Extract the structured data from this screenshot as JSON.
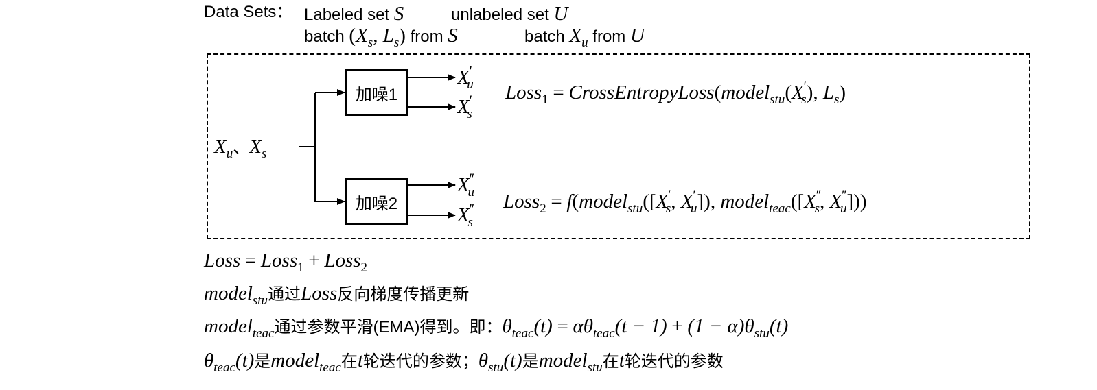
{
  "header": {
    "label": "Data Sets：",
    "labeled_text": "Labeled set",
    "labeled_sym": "S",
    "unlabeled_text": "unlabeled set",
    "unlabeled_sym": "U",
    "batch_text": "batch",
    "batch_xs": "X",
    "batch_s_sub": "s",
    "batch_ls": "L",
    "from_text": "from",
    "batch_u_text": "batch",
    "batch_xu": "X",
    "batch_u_sub": "u",
    "from_u_text": "from"
  },
  "diagram": {
    "input_x": "X",
    "input_u_sub": "u",
    "input_sep": "、",
    "input_s_sub": "s",
    "noise1_label": "加噪1",
    "noise2_label": "加噪2",
    "out1_u": "X",
    "out1_u_sub": "u",
    "out1_u_prime": "′",
    "out1_s": "X",
    "out1_s_sub": "s",
    "out1_s_prime": "′",
    "out2_u": "X",
    "out2_u_sub": "u",
    "out2_u_prime": "″",
    "out2_s": "X",
    "out2_s_sub": "s",
    "out2_s_prime": "″",
    "loss1_name": "Loss",
    "loss1_idx": "1",
    "loss1_eq": "=",
    "loss1_fn": "CrossEntropyLoss",
    "loss1_model": "model",
    "loss1_model_sub": "stu",
    "loss2_name": "Loss",
    "loss2_idx": "2",
    "loss2_eq": "=",
    "loss2_f": "f",
    "loss2_model_stu": "model",
    "loss2_stu_sub": "stu",
    "loss2_model_teac": "model",
    "loss2_teac_sub": "teac"
  },
  "notes": {
    "total_loss": "Loss",
    "total_eq": "=",
    "total_l1": "Loss",
    "total_l1_idx": "1",
    "total_plus": "+",
    "total_l2": "Loss",
    "total_l2_idx": "2",
    "line2_model": "model",
    "line2_sub": "stu",
    "line2_text1": "通过",
    "line2_loss": "Loss",
    "line2_text2": "反向梯度传播更新",
    "line3_model": "model",
    "line3_sub": "teac",
    "line3_text": "通过参数平滑(EMA)得到。即：",
    "line3_theta": "θ",
    "line3_teac": "teac",
    "line3_t": "(t)",
    "line3_eq": "=",
    "line3_alpha": "α",
    "line3_theta2": "θ",
    "line3_teac2": "teac",
    "line3_t1": "(t − 1)",
    "line3_plus": "+",
    "line3_coef": "(1 − α)",
    "line3_theta3": "θ",
    "line3_stu": "stu",
    "line3_t2": "(t)",
    "line4_theta": "θ",
    "line4_teac": "teac",
    "line4_t": "(t)",
    "line4_is": "是",
    "line4_model": "model",
    "line4_model_sub": "teac",
    "line4_in": "在",
    "line4_tvar": "t",
    "line4_round": "轮迭代的参数；",
    "line4_theta2": "θ",
    "line4_stu": "stu",
    "line4_t2": "(t)",
    "line4_is2": "是",
    "line4_model2": "model",
    "line4_model2_sub": "stu",
    "line4_in2": "在",
    "line4_tvar2": "t",
    "line4_round2": "轮迭代的参数"
  }
}
